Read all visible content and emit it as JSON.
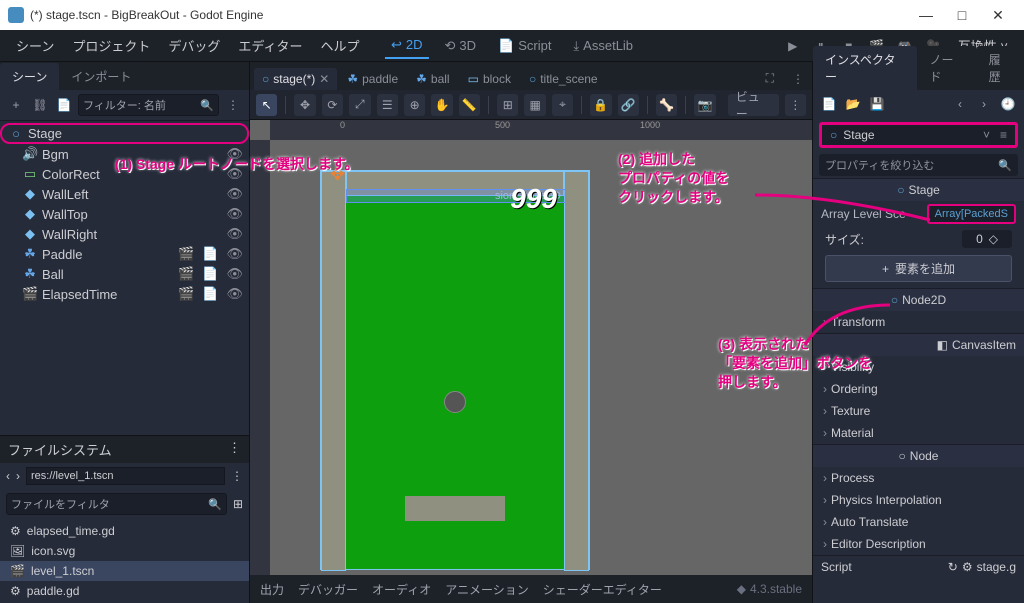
{
  "window": {
    "title": "(*) stage.tscn - BigBreakOut - Godot Engine",
    "min": "—",
    "max": "□",
    "close": "✕"
  },
  "menubar": {
    "items": [
      "シーン",
      "プロジェクト",
      "デバッグ",
      "エディター",
      "ヘルプ"
    ],
    "modes": {
      "2d": "2D",
      "3d": "3D",
      "script": "Script",
      "assetlib": "AssetLib"
    },
    "compat": "互換性"
  },
  "scene_panel": {
    "tabs": {
      "scene": "シーン",
      "import": "インポート"
    },
    "filter_placeholder": "フィルター: 名前",
    "nodes": {
      "root": "Stage",
      "children": [
        {
          "name": "Bgm",
          "icon": "🔊"
        },
        {
          "name": "ColorRect",
          "icon": "▭",
          "color": "#7bd07b"
        },
        {
          "name": "WallLeft",
          "icon": "◆",
          "color": "#7bc0f0"
        },
        {
          "name": "WallTop",
          "icon": "◆",
          "color": "#7bc0f0"
        },
        {
          "name": "WallRight",
          "icon": "◆",
          "color": "#7bc0f0"
        },
        {
          "name": "Paddle",
          "icon": "✦",
          "color": "#64a7e8",
          "extras": true
        },
        {
          "name": "Ball",
          "icon": "✦",
          "color": "#64a7e8",
          "extras": true
        },
        {
          "name": "ElapsedTime",
          "icon": "🎬",
          "color": "#e88050",
          "extras": true
        }
      ]
    }
  },
  "filesystem": {
    "title": "ファイルシステム",
    "path": "res://level_1.tscn",
    "filter_placeholder": "ファイルをフィルタ",
    "items": [
      {
        "name": "elapsed_time.gd",
        "icon": "⚙"
      },
      {
        "name": "icon.svg",
        "icon": "🖼"
      },
      {
        "name": "level_1.tscn",
        "icon": "🎬",
        "selected": true
      },
      {
        "name": "paddle.gd",
        "icon": "⚙"
      }
    ]
  },
  "scene_tabs": [
    {
      "name": "stage(*)",
      "icon": "○",
      "active": true,
      "closable": true
    },
    {
      "name": "paddle",
      "icon": "✦"
    },
    {
      "name": "ball",
      "icon": "✦"
    },
    {
      "name": "block",
      "icon": "▭"
    },
    {
      "name": "title_scene",
      "icon": "○"
    }
  ],
  "viewport_toolbar": {
    "view_label": "ビュー"
  },
  "viewport": {
    "score": "999",
    "coll_label": "sionShape2D"
  },
  "bottom_tabs": [
    "出力",
    "デバッガー",
    "オーディオ",
    "アニメーション",
    "シェーダーエディター"
  ],
  "version": "4.3.stable",
  "inspector": {
    "tabs": {
      "insp": "インスペクター",
      "node": "ノード",
      "hist": "履歴"
    },
    "node_name": "Stage",
    "filter_placeholder": "プロパティを絞り込む",
    "class_header": "Stage",
    "prop_array_label": "Array Level Sce",
    "prop_array_value": "Array[PackedS",
    "size_label": "サイズ:",
    "size_value": "0",
    "add_element": "要素を追加",
    "node2d_header": "Node2D",
    "groups": [
      "Transform",
      "CanvasItem",
      "Visibility",
      "Ordering",
      "Texture",
      "Material"
    ],
    "node_header": "Node",
    "node_groups": [
      "Process",
      "Physics Interpolation",
      "Auto Translate",
      "Editor Description"
    ],
    "script_label": "Script",
    "script_value": "stage.g"
  },
  "annotations": {
    "a1": "(1) Stage ルートノードを選択します。",
    "a2_l1": "(2) 追加した",
    "a2_l2": "プロパティの値を",
    "a2_l3": "クリックします。",
    "a3_l1": "(3) 表示された",
    "a3_l2": "「要素を追加」ボタンを",
    "a3_l3": "押します。"
  }
}
